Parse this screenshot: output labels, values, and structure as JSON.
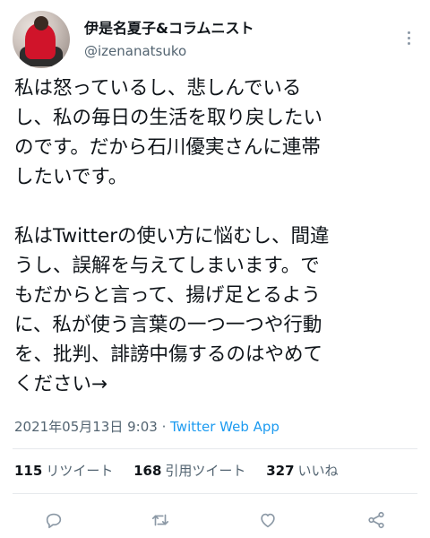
{
  "user": {
    "display_name": "伊是名夏子&コラムニスト",
    "handle": "@izenanatsuko"
  },
  "tweet": {
    "lines": [
      "私は怒っているし、悲しんでいる",
      "し、私の毎日の生活を取り戻したい",
      "のです。だから石川優実さんに連帯",
      "したいです。",
      "",
      "私はTwitterの使い方に悩むし、間違",
      "うし、誤解を与えてしまいます。で",
      "もだからと言って、揚げ足とるよう",
      "に、私が使う言葉の一つ一つや行動",
      "を、批判、誹謗中傷するのはやめて",
      "ください→"
    ]
  },
  "meta": {
    "timestamp": "2021年05月13日 9:03",
    "separator": " · ",
    "app": "Twitter Web App"
  },
  "stats": {
    "retweets_count": "115",
    "retweets_label": "リツイート",
    "quotes_count": "168",
    "quotes_label": "引用ツイート",
    "likes_count": "327",
    "likes_label": "いいね"
  },
  "icons": {
    "more": "more-vertical-icon",
    "reply": "reply-icon",
    "retweet": "retweet-icon",
    "like": "heart-icon",
    "share": "share-icon"
  },
  "colors": {
    "text": "#0f1419",
    "secondary": "#536471",
    "accent": "#1d9bf0"
  }
}
